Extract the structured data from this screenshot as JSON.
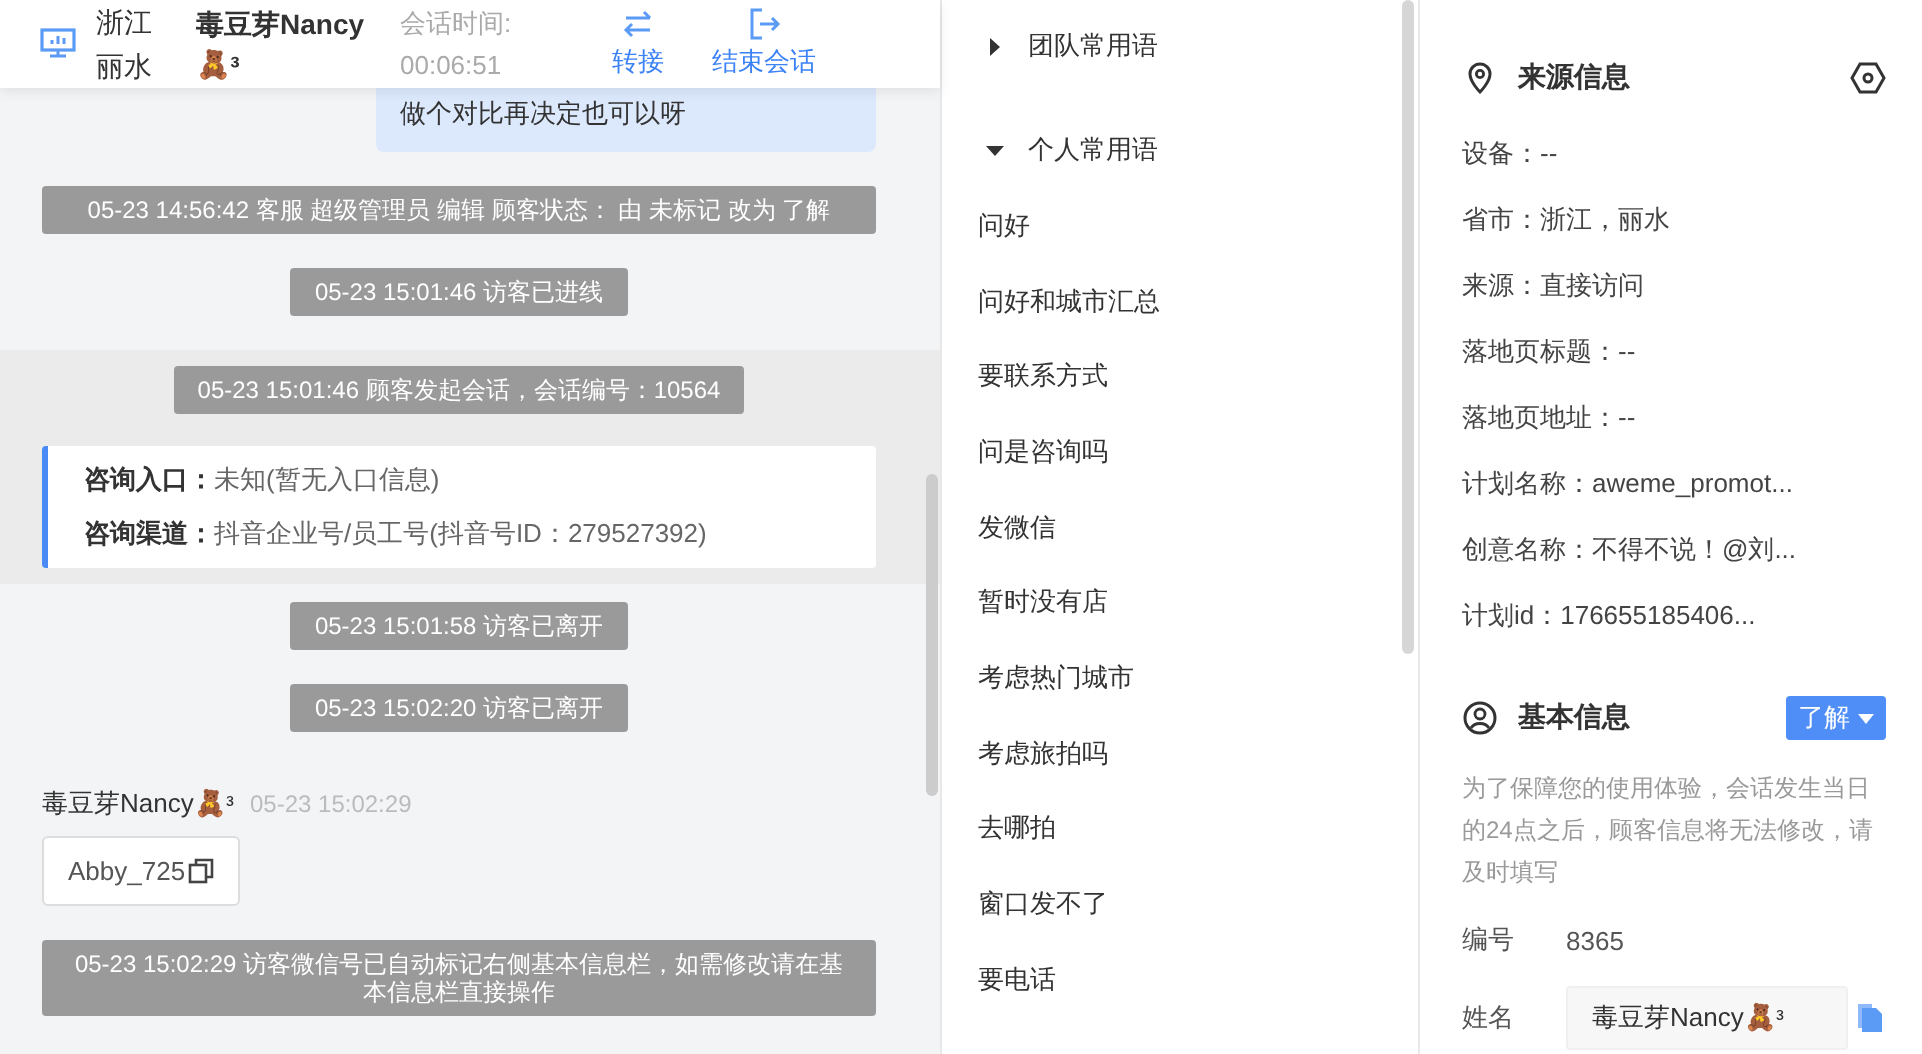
{
  "header": {
    "location": "浙江丽水",
    "visitor_name": "毒豆芽Nancy🧸ᵌ",
    "timer_label": "会话时间:",
    "timer_value": "00:06:51",
    "actions": [
      {
        "kind": "transfer",
        "label": "转接"
      },
      {
        "kind": "end",
        "label": "结束会话"
      }
    ]
  },
  "chat": {
    "messages": [
      {
        "kind": "bubble",
        "text": "做个对比再决定也可以呀"
      },
      {
        "kind": "banner",
        "text": "05-23 14:56:42 客服 超级管理员 编辑 顾客状态： 由 未标记 改为 了解"
      },
      {
        "kind": "system",
        "text": "05-23 15:01:46 访客已进线"
      },
      {
        "kind": "session",
        "text": "05-23 15:01:46 顾客发起会话，会话编号：10564",
        "rows": [
          {
            "label": "咨询入口：",
            "value": "未知(暂无入口信息)"
          },
          {
            "label": "咨询渠道：",
            "value": "抖音企业号/员工号(抖音号ID：279527392)"
          }
        ]
      },
      {
        "kind": "system",
        "text": "05-23 15:01:58 访客已离开"
      },
      {
        "kind": "system",
        "text": "05-23 15:02:20 访客已离开"
      },
      {
        "kind": "sender",
        "name": "毒豆芽Nancy🧸ᵌ",
        "time": "05-23 15:02:29"
      },
      {
        "kind": "copy_card",
        "text": "Abby_725"
      },
      {
        "kind": "banner",
        "text": "05-23 15:02:29 访客微信号已自动标记右侧基本信息栏，如需修改请在基本信息栏直接操作"
      }
    ]
  },
  "phrases": [
    {
      "label": "团队常用语",
      "expanded": false
    },
    {
      "label": "个人常用语",
      "expanded": true,
      "children": [
        {
          "label": "问好"
        },
        {
          "label": "问好和城市汇总"
        },
        {
          "label": "要联系方式"
        },
        {
          "label": "问是咨询吗"
        },
        {
          "label": "发微信"
        },
        {
          "label": "暂时没有店"
        },
        {
          "label": "考虑热门城市"
        },
        {
          "label": "考虑旅拍吗"
        },
        {
          "label": "去哪拍"
        },
        {
          "label": "窗口发不了"
        },
        {
          "label": "要电话"
        }
      ]
    }
  ],
  "source_info": {
    "title": "来源信息",
    "fields": [
      "设备：--",
      "省市：浙江，丽水",
      "来源：直接访问",
      "落地页标题：--",
      "落地页地址：--",
      "计划名称：aweme_promot...",
      "创意名称：不得不说！@刘...",
      "计划id：176655185406..."
    ]
  },
  "basic_info": {
    "title": "基本信息",
    "status": "了解",
    "notice": "为了保障您的使用体验，会话发生当日的24点之后，顾客信息将无法修改，请及时填写",
    "id_label": "编号",
    "id_value": "8365",
    "name_label": "姓名",
    "name_value": "毒豆芽Nancy🧸ᵌ"
  }
}
